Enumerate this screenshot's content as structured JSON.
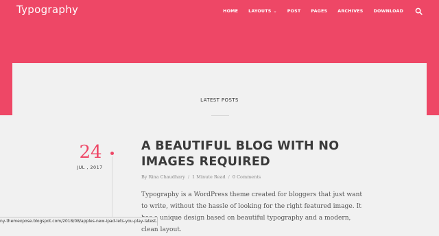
{
  "site": {
    "title": "Typography"
  },
  "nav": {
    "items": [
      {
        "label": "HOME"
      },
      {
        "label": "LAYOUTS"
      },
      {
        "label": "POST"
      },
      {
        "label": "PAGES"
      },
      {
        "label": "ARCHIVES"
      },
      {
        "label": "DOWNLOAD"
      }
    ],
    "search_icon": "search-icon",
    "dropdown_icon": "chevron-down-icon"
  },
  "section": {
    "title": "LATEST POSTS"
  },
  "post": {
    "date_day": "24",
    "date_month_year": "JUL , 2017",
    "title": "A BEAUTIFUL BLOG WITH NO IMAGES REQUIRED",
    "author": "By Rina Chaudhary",
    "meta_separator": "/",
    "read_time": "1 Minute Read",
    "comments": "0 Comments",
    "excerpt": "Typography is a WordPress theme created for bloggers that just want to write, without the hassle of looking for the right featured image. It has a unique design based on beautiful typography and a modern, clean layout."
  },
  "status_bar": {
    "url": "ny-themexpose.blogspot.com/2018/08/apples-new-ipad-lets-you-play-latest.html"
  },
  "colors": {
    "accent": "#ee4766",
    "background": "#f1f1f1",
    "title_text": "#3a3a3a"
  }
}
